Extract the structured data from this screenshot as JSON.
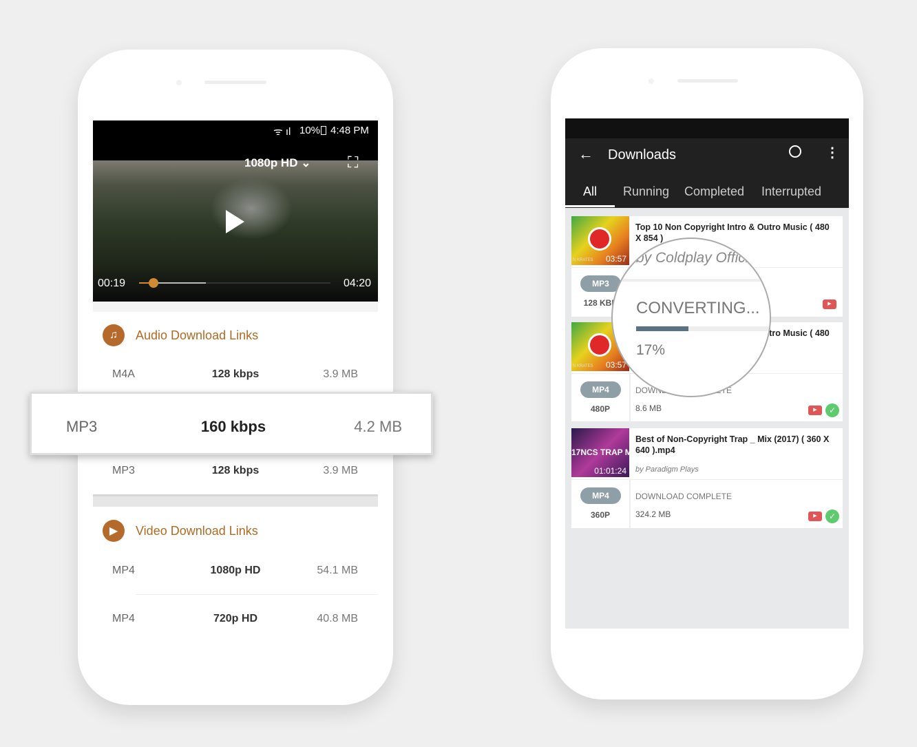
{
  "left_phone": {
    "status_bar": {
      "battery": "10%",
      "time": "4:48 PM"
    },
    "player": {
      "quality": "1080p HD",
      "elapsed": "00:19",
      "duration": "04:20",
      "progress_percent": 7.5,
      "buffered_percent": 35
    },
    "audio": {
      "title": "Audio Download Links",
      "rows": [
        {
          "format": "M4A",
          "quality": "128 kbps",
          "size": "3.9 MB"
        },
        {
          "format": "MP3",
          "quality": "160 kbps",
          "size": "4.2 MB"
        },
        {
          "format": "MP3",
          "quality": "128 kbps",
          "size": "3.9 MB"
        }
      ]
    },
    "video": {
      "title": "Video Download Links",
      "rows": [
        {
          "format": "MP4",
          "quality": "1080p HD",
          "size": "54.1 MB"
        },
        {
          "format": "MP4",
          "quality": "720p HD",
          "size": "40.8 MB"
        }
      ]
    }
  },
  "right_phone": {
    "toolbar": {
      "title": "Downloads"
    },
    "tabs": [
      {
        "label": "All",
        "active": true
      },
      {
        "label": "Running"
      },
      {
        "label": "Completed"
      },
      {
        "label": "Interrupted"
      }
    ],
    "items": [
      {
        "title": "Top 10 Non Copyright Intro & Outro Music ( 480 X 854 )",
        "by": "by Coldplay Official",
        "thumb_text": "N KRATES",
        "duration": "03:57",
        "format": "MP3",
        "quality": "128 KBP"
      },
      {
        "title": "Top 10 Non Copyright Intro & Outro Music ( 480 X 854 )",
        "thumb_text": "N KRATES",
        "duration": "03:57",
        "format": "MP4",
        "quality": "480P",
        "status": "DOWNLOAD COMPLETE",
        "size": "8.6 MB"
      },
      {
        "title": "Best of Non-Copyright Trap _ Mix (2017) ( 360 X 640 ).mp4",
        "by": "by Paradigm Plays",
        "thumb_text": "17NCS TRAP M",
        "duration": "01:01:24",
        "format": "MP4",
        "quality": "360P",
        "status": "DOWNLOAD COMPLETE",
        "size": "324.2 MB"
      }
    ],
    "magnifier": {
      "status": "CONVERTING...",
      "percent_label": "17%",
      "progress_percent": 17
    }
  },
  "colors": {
    "accent": "#b5692a",
    "toolbar": "#212121",
    "badge": "#8f9fa8",
    "progress": "#5b7282"
  }
}
